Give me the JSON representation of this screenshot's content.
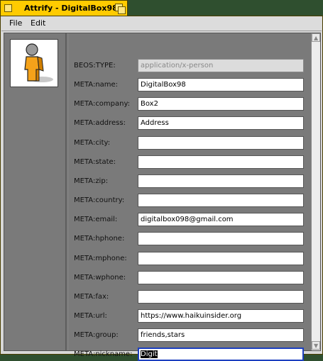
{
  "window": {
    "title": "Attrify - DigitalBox98",
    "tab_color": "#ffcb00"
  },
  "menu": {
    "items": [
      "File",
      "Edit"
    ]
  },
  "icon": {
    "name": "person-icon"
  },
  "fields": [
    {
      "label": "BEOS:TYPE:",
      "value": "application/x-person",
      "state": "disabled"
    },
    {
      "label": "META:name:",
      "value": "DigitalBox98"
    },
    {
      "label": "META:company:",
      "value": "Box2"
    },
    {
      "label": "META:address:",
      "value": "Address"
    },
    {
      "label": "META:city:",
      "value": ""
    },
    {
      "label": "META:state:",
      "value": ""
    },
    {
      "label": "META:zip:",
      "value": ""
    },
    {
      "label": "META:country:",
      "value": ""
    },
    {
      "label": "META:email:",
      "value": "digitalbox098@gmail.com"
    },
    {
      "label": "META:hphone:",
      "value": ""
    },
    {
      "label": "META:mphone:",
      "value": ""
    },
    {
      "label": "META:wphone:",
      "value": ""
    },
    {
      "label": "META:fax:",
      "value": ""
    },
    {
      "label": "META:url:",
      "value": "https://www.haikuinsider.org"
    },
    {
      "label": "META:group:",
      "value": "friends,stars"
    },
    {
      "label": "META:nickname:",
      "value": "Digit",
      "state": "focused-selected"
    }
  ]
}
